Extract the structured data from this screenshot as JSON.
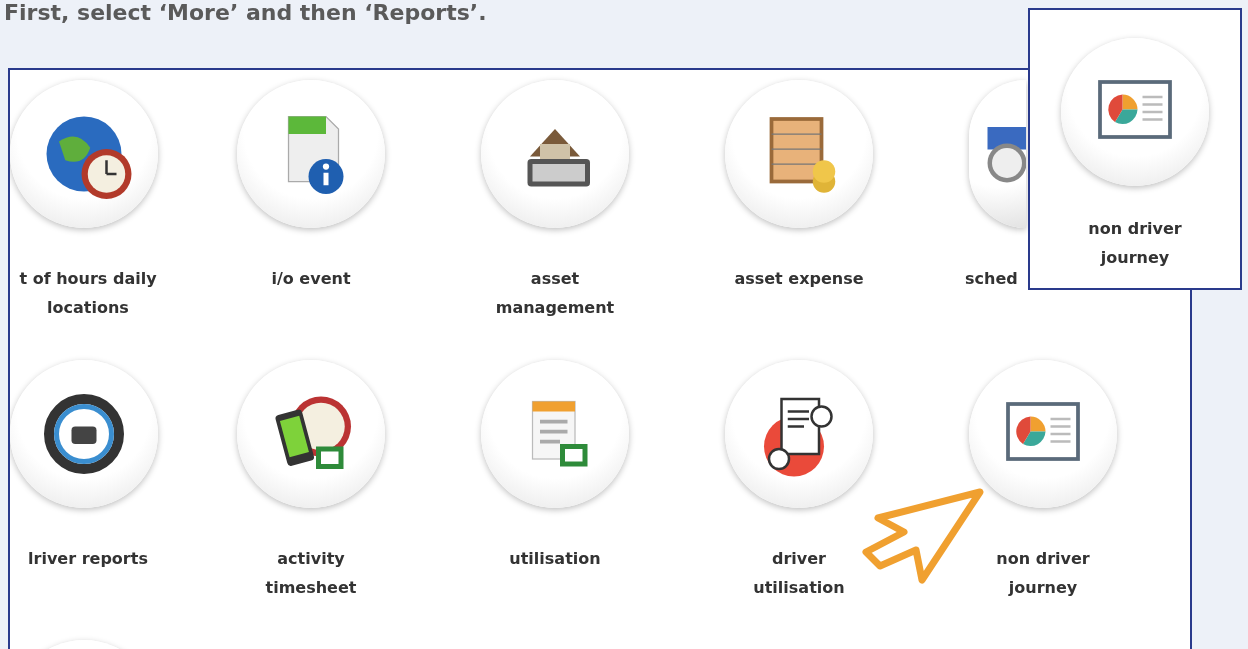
{
  "instruction": "First, select ‘More’ and then ‘Reports’.",
  "tiles": [
    {
      "label": "t of hours daily locations",
      "kind": "globe-clock"
    },
    {
      "label": "i/o event",
      "kind": "info-file"
    },
    {
      "label": "asset management",
      "kind": "house-calculator"
    },
    {
      "label": "asset expense",
      "kind": "abacus"
    },
    {
      "label": "sched",
      "kind": "clock-stack"
    },
    {
      "label": "lriver reports",
      "kind": "steering-wheel"
    },
    {
      "label": "activity timesheet",
      "kind": "phone-timesheet"
    },
    {
      "label": "utilisation",
      "kind": "spreadsheet"
    },
    {
      "label": "driver utilisation",
      "kind": "document-person"
    },
    {
      "label": "non driver journey",
      "kind": "pie-report"
    }
  ],
  "callout": {
    "label": "non driver journey",
    "kind": "pie-report"
  }
}
